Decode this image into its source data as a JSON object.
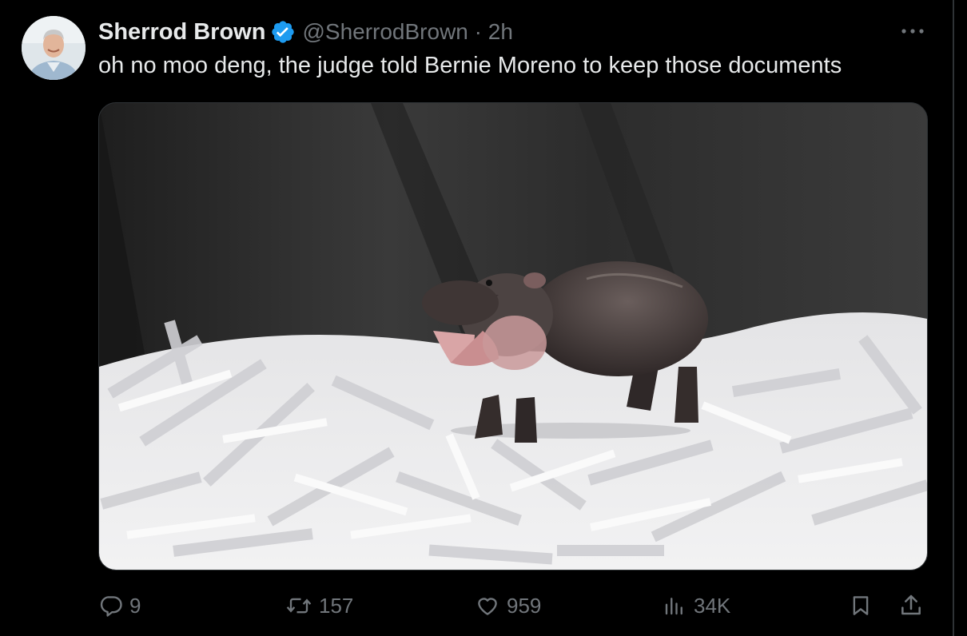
{
  "tweet": {
    "author_name": "Sherrod Brown",
    "author_handle": "@SherrodBrown",
    "separator": "·",
    "time": "2h",
    "text": "oh no moo deng, the judge told Bernie Moreno to keep those documents",
    "verified_color": "#1d9bf0"
  },
  "actions": {
    "replies": "9",
    "retweets": "157",
    "likes": "959",
    "views": "34K"
  },
  "icons": [
    "avatar",
    "verified-badge-icon",
    "more-icon",
    "reply-icon",
    "retweet-icon",
    "like-icon",
    "views-icon",
    "bookmark-icon",
    "share-icon"
  ],
  "colors": {
    "background": "#000000",
    "text": "#e7e9ea",
    "secondary": "#71767b",
    "border": "#2f3336"
  }
}
